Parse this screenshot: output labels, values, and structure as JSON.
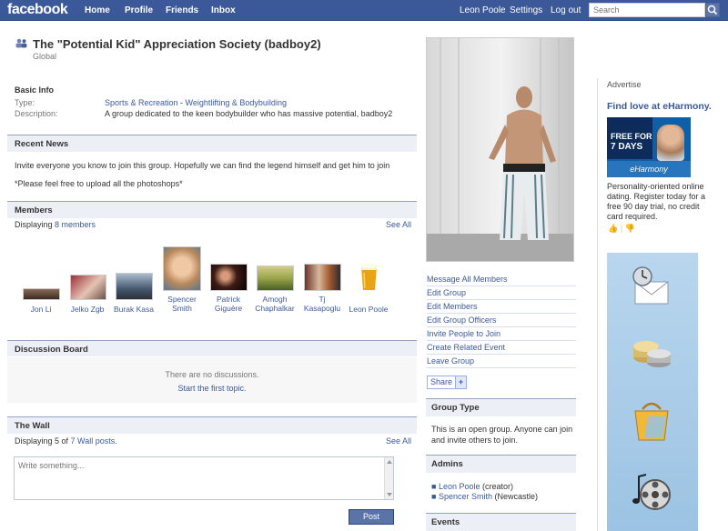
{
  "topbar": {
    "logo": "facebook",
    "nav": [
      "Home",
      "Profile",
      "Friends",
      "Inbox"
    ],
    "user": "Leon Poole",
    "settings": "Settings",
    "logout": "Log out",
    "search_placeholder": "Search",
    "bg_color": "#3b5998"
  },
  "header": {
    "title": "The \"Potential Kid\" Appreciation Society (badboy2)",
    "subtitle": "Global"
  },
  "basic_info": {
    "heading": "Basic Info",
    "type_label": "Type:",
    "type_category": "Sports & Recreation",
    "type_sep": " - ",
    "type_sub": "Weightlifting & Bodybuilding",
    "desc_label": "Description:",
    "desc_value": "A group dedicated to the keen bodybuilder who has massive potential, badboy2"
  },
  "recent_news": {
    "heading": "Recent News",
    "line1": "Invite everyone you know to join this group. Hopefully we can find the legend himself and get him to join",
    "line2": "*Please feel free to upload all the photoshops*"
  },
  "members": {
    "heading": "Members",
    "displaying_prefix": "Displaying ",
    "displaying_link": "8 members",
    "see_all": "See All",
    "list": [
      {
        "line1": "Jon Li",
        "line2": ""
      },
      {
        "line1": "Jelko Zgb",
        "line2": ""
      },
      {
        "line1": "Burak Kasa",
        "line2": ""
      },
      {
        "line1": "Spencer",
        "line2": "Smith"
      },
      {
        "line1": "Patrick",
        "line2": "Giguère"
      },
      {
        "line1": "Amogh",
        "line2": "Chaphalkar"
      },
      {
        "line1": "Tj",
        "line2": "Kasapoglu"
      },
      {
        "line1": "Leon Poole",
        "line2": ""
      }
    ]
  },
  "discussion": {
    "heading": "Discussion Board",
    "empty": "There are no discussions.",
    "start": "Start the first topic."
  },
  "wall": {
    "heading": "The Wall",
    "displaying_prefix": "Displaying 5 of ",
    "displaying_link": "7 Wall posts",
    "displaying_suffix": ".",
    "see_all": "See All",
    "input_placeholder": "Write something...",
    "post": "Post"
  },
  "actions": [
    "Message All Members",
    "Edit Group",
    "Edit Members",
    "Edit Group Officers",
    "Invite People to Join",
    "Create Related Event",
    "Leave Group"
  ],
  "share": {
    "label": "Share",
    "plus": "+"
  },
  "group_type": {
    "heading": "Group Type",
    "text": "This is an open group. Anyone can join and invite others to join."
  },
  "admins": {
    "heading": "Admins",
    "list": [
      {
        "name": "Leon Poole",
        "role": " (creator)"
      },
      {
        "name": "Spencer Smith",
        "role": " (Newcastle)"
      }
    ]
  },
  "events": {
    "heading": "Events"
  },
  "ad": {
    "label": "Advertise",
    "title": "Find love at eHarmony.",
    "image_line1": "FREE FOR",
    "image_line2": "7 DAYS",
    "image_brand": "eHarmony",
    "text": "Personality-oriented online dating. Register today for a free 90 day trial, no credit card required."
  }
}
